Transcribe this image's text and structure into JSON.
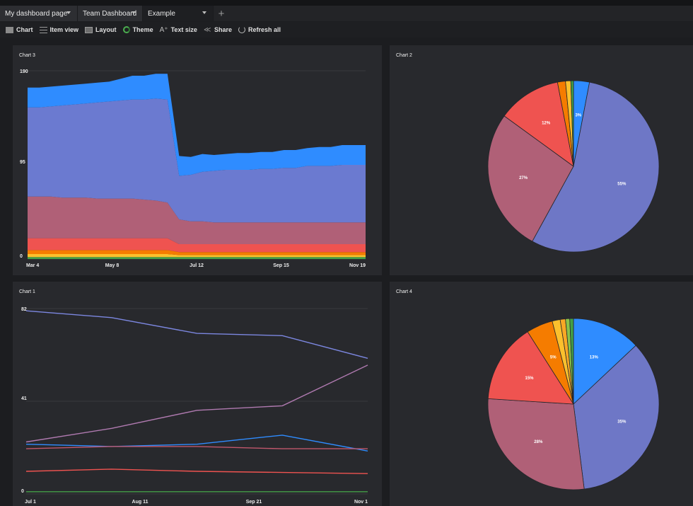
{
  "tabs": [
    {
      "label": "My dashboard page"
    },
    {
      "label": "Team Dashboard"
    },
    {
      "label": "Example"
    }
  ],
  "toolbar": {
    "chart": "Chart",
    "item_view": "Item view",
    "layout": "Layout",
    "theme": "Theme",
    "text_size": "Text size",
    "share": "Share",
    "refresh_all": "Refresh all"
  },
  "panels": {
    "chart3": {
      "title": "Chart 3"
    },
    "chart2": {
      "title": "Chart 2"
    },
    "chart1": {
      "title": "Chart 1"
    },
    "chart4": {
      "title": "Chart 4"
    }
  },
  "chart_data": [
    {
      "id": "chart3",
      "type": "area",
      "title": "Chart 3",
      "stacked": true,
      "ylim": [
        0,
        190
      ],
      "yticks": [
        0,
        95,
        190
      ],
      "xticklabels": [
        "Mar 4",
        "May 8",
        "Jul 12",
        "Sep 15",
        "Nov 19"
      ],
      "colors": [
        "#43a047",
        "#fbc02d",
        "#f57c00",
        "#ef5350",
        "#b06077",
        "#6b7ad0",
        "#2f8cff"
      ],
      "series": [
        {
          "values": [
            2,
            2,
            2,
            2,
            2,
            2,
            2,
            2,
            2,
            2,
            2,
            2,
            2,
            2,
            2,
            2,
            2,
            2,
            2,
            2,
            2,
            2,
            2,
            2,
            2,
            2,
            2,
            2,
            2,
            2
          ]
        },
        {
          "values": [
            3,
            3,
            3,
            3,
            3,
            3,
            3,
            3,
            3,
            3,
            3,
            3,
            3,
            2,
            2,
            2,
            2,
            2,
            2,
            2,
            2,
            2,
            2,
            2,
            2,
            2,
            2,
            2,
            2,
            2
          ]
        },
        {
          "values": [
            4,
            4,
            4,
            4,
            4,
            4,
            4,
            4,
            4,
            4,
            4,
            4,
            4,
            3,
            3,
            3,
            3,
            3,
            3,
            3,
            3,
            3,
            3,
            3,
            3,
            3,
            3,
            3,
            3,
            3
          ]
        },
        {
          "values": [
            12,
            12,
            12,
            12,
            12,
            12,
            12,
            12,
            12,
            12,
            12,
            12,
            12,
            8,
            8,
            8,
            8,
            8,
            8,
            8,
            8,
            8,
            8,
            8,
            8,
            8,
            8,
            8,
            8,
            8
          ]
        },
        {
          "values": [
            42,
            42,
            42,
            41,
            41,
            41,
            40,
            40,
            40,
            40,
            39,
            38,
            36,
            25,
            23,
            23,
            22,
            22,
            22,
            22,
            22,
            22,
            22,
            22,
            22,
            22,
            22,
            22,
            22,
            22
          ]
        },
        {
          "values": [
            90,
            90,
            91,
            93,
            94,
            95,
            97,
            98,
            99,
            100,
            101,
            103,
            104,
            44,
            47,
            50,
            52,
            53,
            53,
            53,
            54,
            54,
            55,
            55,
            57,
            57,
            57,
            58,
            58,
            58
          ]
        },
        {
          "values": [
            20,
            20,
            20,
            20,
            20,
            20,
            20,
            20,
            22,
            24,
            24,
            25,
            26,
            20,
            18,
            18,
            16,
            16,
            17,
            17,
            17,
            17,
            18,
            18,
            18,
            19,
            19,
            20,
            20,
            20
          ]
        }
      ]
    },
    {
      "id": "chart2",
      "type": "pie",
      "title": "Chart 2",
      "slices": [
        {
          "value": 3,
          "label": "3%",
          "color": "#2f8cff"
        },
        {
          "value": 55,
          "label": "55%",
          "color": "#6e77c6"
        },
        {
          "value": 27,
          "label": "27%",
          "color": "#b06077"
        },
        {
          "value": 12,
          "label": "12%",
          "color": "#ef5350"
        },
        {
          "value": 1.5,
          "label": "",
          "color": "#f57c00"
        },
        {
          "value": 1,
          "label": "",
          "color": "#fbc02d"
        },
        {
          "value": 0.5,
          "label": "",
          "color": "#43a047"
        }
      ]
    },
    {
      "id": "chart1",
      "type": "line",
      "title": "Chart 1",
      "ylim": [
        0,
        82
      ],
      "yticks": [
        0,
        41,
        82
      ],
      "xticklabels": [
        "Jul 1",
        "Aug 11",
        "Sep 21",
        "Nov 1"
      ],
      "series": [
        {
          "color": "#7c87e0",
          "x": [
            0,
            0.25,
            0.5,
            0.75,
            1
          ],
          "values": [
            81,
            78,
            71,
            70,
            60
          ]
        },
        {
          "color": "#b07ab0",
          "x": [
            0,
            0.25,
            0.5,
            0.75,
            1
          ],
          "values": [
            23,
            29,
            37,
            39,
            57
          ]
        },
        {
          "color": "#2f8cff",
          "x": [
            0,
            0.25,
            0.5,
            0.75,
            1
          ],
          "values": [
            22,
            21,
            22,
            26,
            19
          ]
        },
        {
          "color": "#c0576c",
          "x": [
            0,
            0.25,
            0.5,
            0.75,
            1
          ],
          "values": [
            20,
            21,
            21,
            20,
            20
          ]
        },
        {
          "color": "#ef5350",
          "x": [
            0,
            0.25,
            0.5,
            0.75,
            1
          ],
          "values": [
            10,
            11,
            10,
            9.5,
            9
          ]
        },
        {
          "color": "#43a047",
          "x": [
            0,
            0.25,
            0.5,
            0.75,
            1
          ],
          "values": [
            1,
            1,
            1,
            1,
            1
          ]
        }
      ]
    },
    {
      "id": "chart4",
      "type": "pie",
      "title": "Chart 4",
      "slices": [
        {
          "value": 13,
          "label": "13%",
          "color": "#2f8cff"
        },
        {
          "value": 35,
          "label": "35%",
          "color": "#6e77c6"
        },
        {
          "value": 28,
          "label": "28%",
          "color": "#b06077"
        },
        {
          "value": 15,
          "label": "15%",
          "color": "#ef5350"
        },
        {
          "value": 5,
          "label": "5%",
          "color": "#f57c00"
        },
        {
          "value": 1.5,
          "label": "",
          "color": "#fbc02d"
        },
        {
          "value": 1,
          "label": "",
          "color": "#f9a825"
        },
        {
          "value": 0.8,
          "label": "",
          "color": "#8bc34a"
        },
        {
          "value": 0.7,
          "label": "",
          "color": "#43a047"
        }
      ]
    }
  ]
}
